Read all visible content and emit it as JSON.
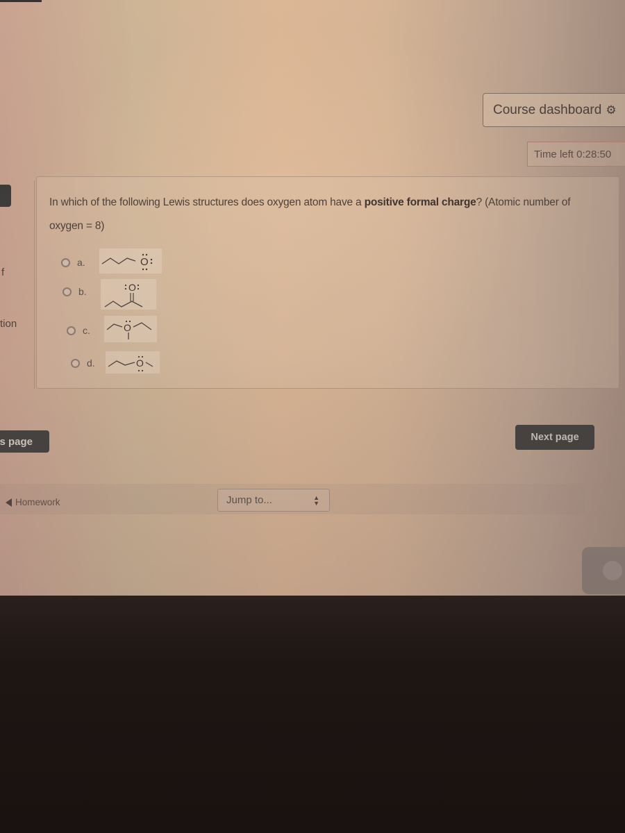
{
  "header": {
    "course_dashboard_label": "Course dashboard",
    "course_dashboard_icon": "gear-icon",
    "timer_label": "Time left 0:28:50"
  },
  "left_sidebar": {
    "fragments": [
      "f",
      "tion"
    ]
  },
  "question": {
    "text_before_bold": "In which of the following Lewis structures does oxygen atom have a ",
    "text_bold": "positive formal charge",
    "text_after_bold": "? (Atomic number of oxygen = 8)",
    "answers": [
      {
        "letter": "a.",
        "structure": "butyl-O with three lone pairs (O with dots top, right, bottom)"
      },
      {
        "letter": "b.",
        "structure": ":O: double-bonded ketone (2-pentanone)"
      },
      {
        "letter": "c.",
        "structure": "O bonded to three carbon chains, one lone pair"
      },
      {
        "letter": "d.",
        "structure": "propyl-O-methyl ether with two lone pairs"
      }
    ],
    "selected": null
  },
  "navigation": {
    "previous_page_label": "us page",
    "next_page_label": "Next page",
    "homework_link_label": "Homework",
    "jump_to_placeholder": "Jump to..."
  },
  "colors": {
    "button_dark": "#3f3e3b",
    "timer_border": "#b27d72",
    "text_main": "#4a3f3a"
  }
}
